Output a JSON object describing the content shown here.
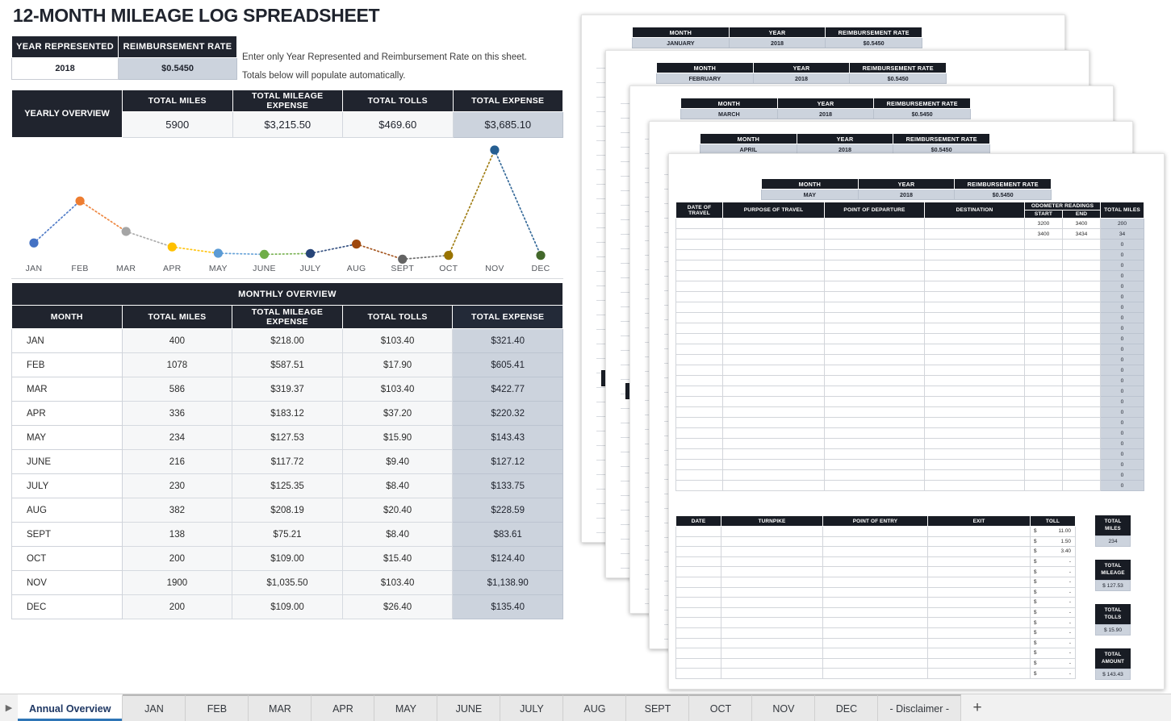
{
  "title": "12-MONTH MILEAGE LOG SPREADSHEET",
  "setup": {
    "headers": [
      "YEAR REPRESENTED",
      "REIMBURSEMENT RATE"
    ],
    "year": "2018",
    "rate": "$0.5450"
  },
  "instructions": {
    "line1": "Enter only Year Represented and Reimbursement Rate on this sheet.",
    "line2": "Totals below will populate automatically."
  },
  "yearly_overview": {
    "label": "YEARLY OVERVIEW",
    "headers": [
      "TOTAL MILES",
      "TOTAL MILEAGE EXPENSE",
      "TOTAL TOLLS",
      "TOTAL EXPENSE"
    ],
    "values": [
      "5900",
      "$3,215.50",
      "$469.60",
      "$3,685.10"
    ]
  },
  "monthly_overview": {
    "title": "MONTHLY OVERVIEW",
    "headers": [
      "MONTH",
      "TOTAL MILES",
      "TOTAL MILEAGE EXPENSE",
      "TOTAL TOLLS",
      "TOTAL EXPENSE"
    ],
    "rows": [
      [
        "JAN",
        "400",
        "$218.00",
        "$103.40",
        "$321.40"
      ],
      [
        "FEB",
        "1078",
        "$587.51",
        "$17.90",
        "$605.41"
      ],
      [
        "MAR",
        "586",
        "$319.37",
        "$103.40",
        "$422.77"
      ],
      [
        "APR",
        "336",
        "$183.12",
        "$37.20",
        "$220.32"
      ],
      [
        "MAY",
        "234",
        "$127.53",
        "$15.90",
        "$143.43"
      ],
      [
        "JUNE",
        "216",
        "$117.72",
        "$9.40",
        "$127.12"
      ],
      [
        "JULY",
        "230",
        "$125.35",
        "$8.40",
        "$133.75"
      ],
      [
        "AUG",
        "382",
        "$208.19",
        "$20.40",
        "$228.59"
      ],
      [
        "SEPT",
        "138",
        "$75.21",
        "$8.40",
        "$83.61"
      ],
      [
        "OCT",
        "200",
        "$109.00",
        "$15.40",
        "$124.40"
      ],
      [
        "NOV",
        "1900",
        "$1,035.50",
        "$103.40",
        "$1,138.90"
      ],
      [
        "DEC",
        "200",
        "$109.00",
        "$26.40",
        "$135.40"
      ]
    ]
  },
  "chart_data": {
    "type": "line",
    "title": "",
    "xlabel": "",
    "ylabel": "",
    "categories": [
      "JAN",
      "FEB",
      "MAR",
      "APR",
      "MAY",
      "JUNE",
      "JULY",
      "AUG",
      "SEPT",
      "OCT",
      "NOV",
      "DEC"
    ],
    "values": [
      400,
      1078,
      586,
      336,
      234,
      216,
      230,
      382,
      138,
      200,
      1900,
      200
    ],
    "ylim": [
      0,
      1900
    ],
    "grid": false,
    "legend": "none",
    "line_style": "dotted",
    "marker": "circle",
    "marker_colors": [
      "#4472c4",
      "#ed7d31",
      "#a5a5a5",
      "#ffc000",
      "#5b9bd5",
      "#70ad47",
      "#264478",
      "#9e480e",
      "#636363",
      "#997300",
      "#255e91",
      "#43682b"
    ]
  },
  "stacked_sheets": {
    "mini_headers": [
      "MONTH",
      "YEAR",
      "REIMBURSEMENT RATE"
    ],
    "sheets": [
      {
        "month": "JANUARY",
        "year": "2018",
        "rate": "$0.5450"
      },
      {
        "month": "FEBRUARY",
        "year": "2018",
        "rate": "$0.5450"
      },
      {
        "month": "MARCH",
        "year": "2018",
        "rate": "$0.5450"
      },
      {
        "month": "APRIL",
        "year": "2018",
        "rate": "$0.5450"
      },
      {
        "month": "MAY",
        "year": "2018",
        "rate": "$0.5450"
      }
    ]
  },
  "front_sheet": {
    "month": "MAY",
    "year": "2018",
    "rate": "$0.5450",
    "mileage_headers": {
      "date": "DATE OF TRAVEL",
      "purpose": "PURPOSE OF TRAVEL",
      "departure": "POINT OF DEPARTURE",
      "destination": "DESTINATION",
      "odometer": "ODOMETER READINGS",
      "start": "START",
      "end": "END",
      "total_miles": "TOTAL MILES"
    },
    "mileage_rows": [
      {
        "start": "3200",
        "end": "3400",
        "miles": "200"
      },
      {
        "start": "3400",
        "end": "3434",
        "miles": "34"
      },
      {
        "start": "",
        "end": "",
        "miles": "0"
      },
      {
        "start": "",
        "end": "",
        "miles": "0"
      },
      {
        "start": "",
        "end": "",
        "miles": "0"
      },
      {
        "start": "",
        "end": "",
        "miles": "0"
      },
      {
        "start": "",
        "end": "",
        "miles": "0"
      },
      {
        "start": "",
        "end": "",
        "miles": "0"
      },
      {
        "start": "",
        "end": "",
        "miles": "0"
      },
      {
        "start": "",
        "end": "",
        "miles": "0"
      },
      {
        "start": "",
        "end": "",
        "miles": "0"
      },
      {
        "start": "",
        "end": "",
        "miles": "0"
      },
      {
        "start": "",
        "end": "",
        "miles": "0"
      },
      {
        "start": "",
        "end": "",
        "miles": "0"
      },
      {
        "start": "",
        "end": "",
        "miles": "0"
      },
      {
        "start": "",
        "end": "",
        "miles": "0"
      },
      {
        "start": "",
        "end": "",
        "miles": "0"
      },
      {
        "start": "",
        "end": "",
        "miles": "0"
      },
      {
        "start": "",
        "end": "",
        "miles": "0"
      },
      {
        "start": "",
        "end": "",
        "miles": "0"
      },
      {
        "start": "",
        "end": "",
        "miles": "0"
      },
      {
        "start": "",
        "end": "",
        "miles": "0"
      },
      {
        "start": "",
        "end": "",
        "miles": "0"
      },
      {
        "start": "",
        "end": "",
        "miles": "0"
      },
      {
        "start": "",
        "end": "",
        "miles": "0"
      },
      {
        "start": "",
        "end": "",
        "miles": "0"
      }
    ],
    "toll_headers": [
      "DATE",
      "TURNPIKE",
      "POINT OF ENTRY",
      "EXIT",
      "TOLL"
    ],
    "toll_rows": [
      "11.00",
      "1.50",
      "3.40",
      "-",
      "-",
      "-",
      "-",
      "-",
      "-",
      "-",
      "-",
      "-",
      "-",
      "-",
      "-"
    ],
    "summary": [
      {
        "caption": "TOTAL MILES",
        "value": "234"
      },
      {
        "caption": "TOTAL MILEAGE",
        "value": "$   127.53"
      },
      {
        "caption": "TOTAL TOLLS",
        "value": "$   15.90"
      },
      {
        "caption": "TOTAL AMOUNT",
        "value": "$   143.43"
      }
    ]
  },
  "tabbar": {
    "nav_arrow": "▶",
    "tabs": [
      "Annual Overview",
      "JAN",
      "FEB",
      "MAR",
      "APR",
      "MAY",
      "JUNE",
      "JULY",
      "AUG",
      "SEPT",
      "OCT",
      "NOV",
      "DEC",
      "- Disclaimer -"
    ],
    "active_tab": "Annual Overview",
    "add_label": "+"
  }
}
